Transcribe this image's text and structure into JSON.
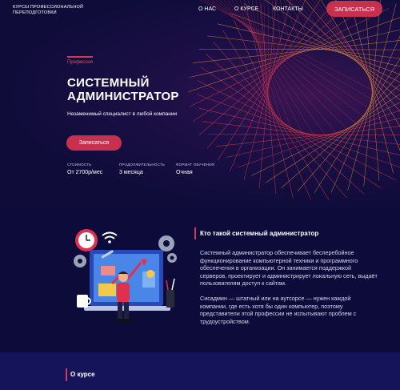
{
  "header": {
    "logo_line1": "КУРСЫ ПРОФЕССИОНАЛЬНОЙ",
    "logo_line2": "ПЕРЕПОДГОТОВКИ",
    "nav": [
      "О НАС",
      "О КУРСЕ",
      "КОНТАКТЫ"
    ],
    "cta": "ЗАПИСАТЬСЯ"
  },
  "hero": {
    "tag": "Профессия",
    "title_line1": "СИСТЕМНЫЙ",
    "title_line2": "АДМИНИСТРАТОР",
    "subtitle": "Незаменимый специалист в любой компании",
    "cta": "Записаться",
    "stats": [
      {
        "label": "СТОИМОСТЬ",
        "value": "От 2700р/мес"
      },
      {
        "label": "ПРОДОЛЖИТЕЛЬНОСТЬ",
        "value": "3 месяца"
      },
      {
        "label": "ФОРМАТ ОБУЧЕНИЯ",
        "value": "Очная"
      }
    ]
  },
  "about": {
    "title": "Кто такой системный администратор",
    "p1": "Системный администратор обеспечивает бесперебойное функционирование компьютерной техники и программного обеспечения в организации. Он занимается поддержкой серверов, проектирует и администрирует локальную сеть, выдаёт пользователям доступ к сайтам.",
    "p2": "Сисадмин — штатный или на аутсорсе — нужен каждой компании, где есть хотя бы один компьютер, поэтому представители этой профессии не испытывают проблем с трудоустройством."
  },
  "course": {
    "title": "О курсе"
  },
  "colors": {
    "accent": "#c8304f",
    "background": "#0c0b3a",
    "section": "#15135a"
  }
}
